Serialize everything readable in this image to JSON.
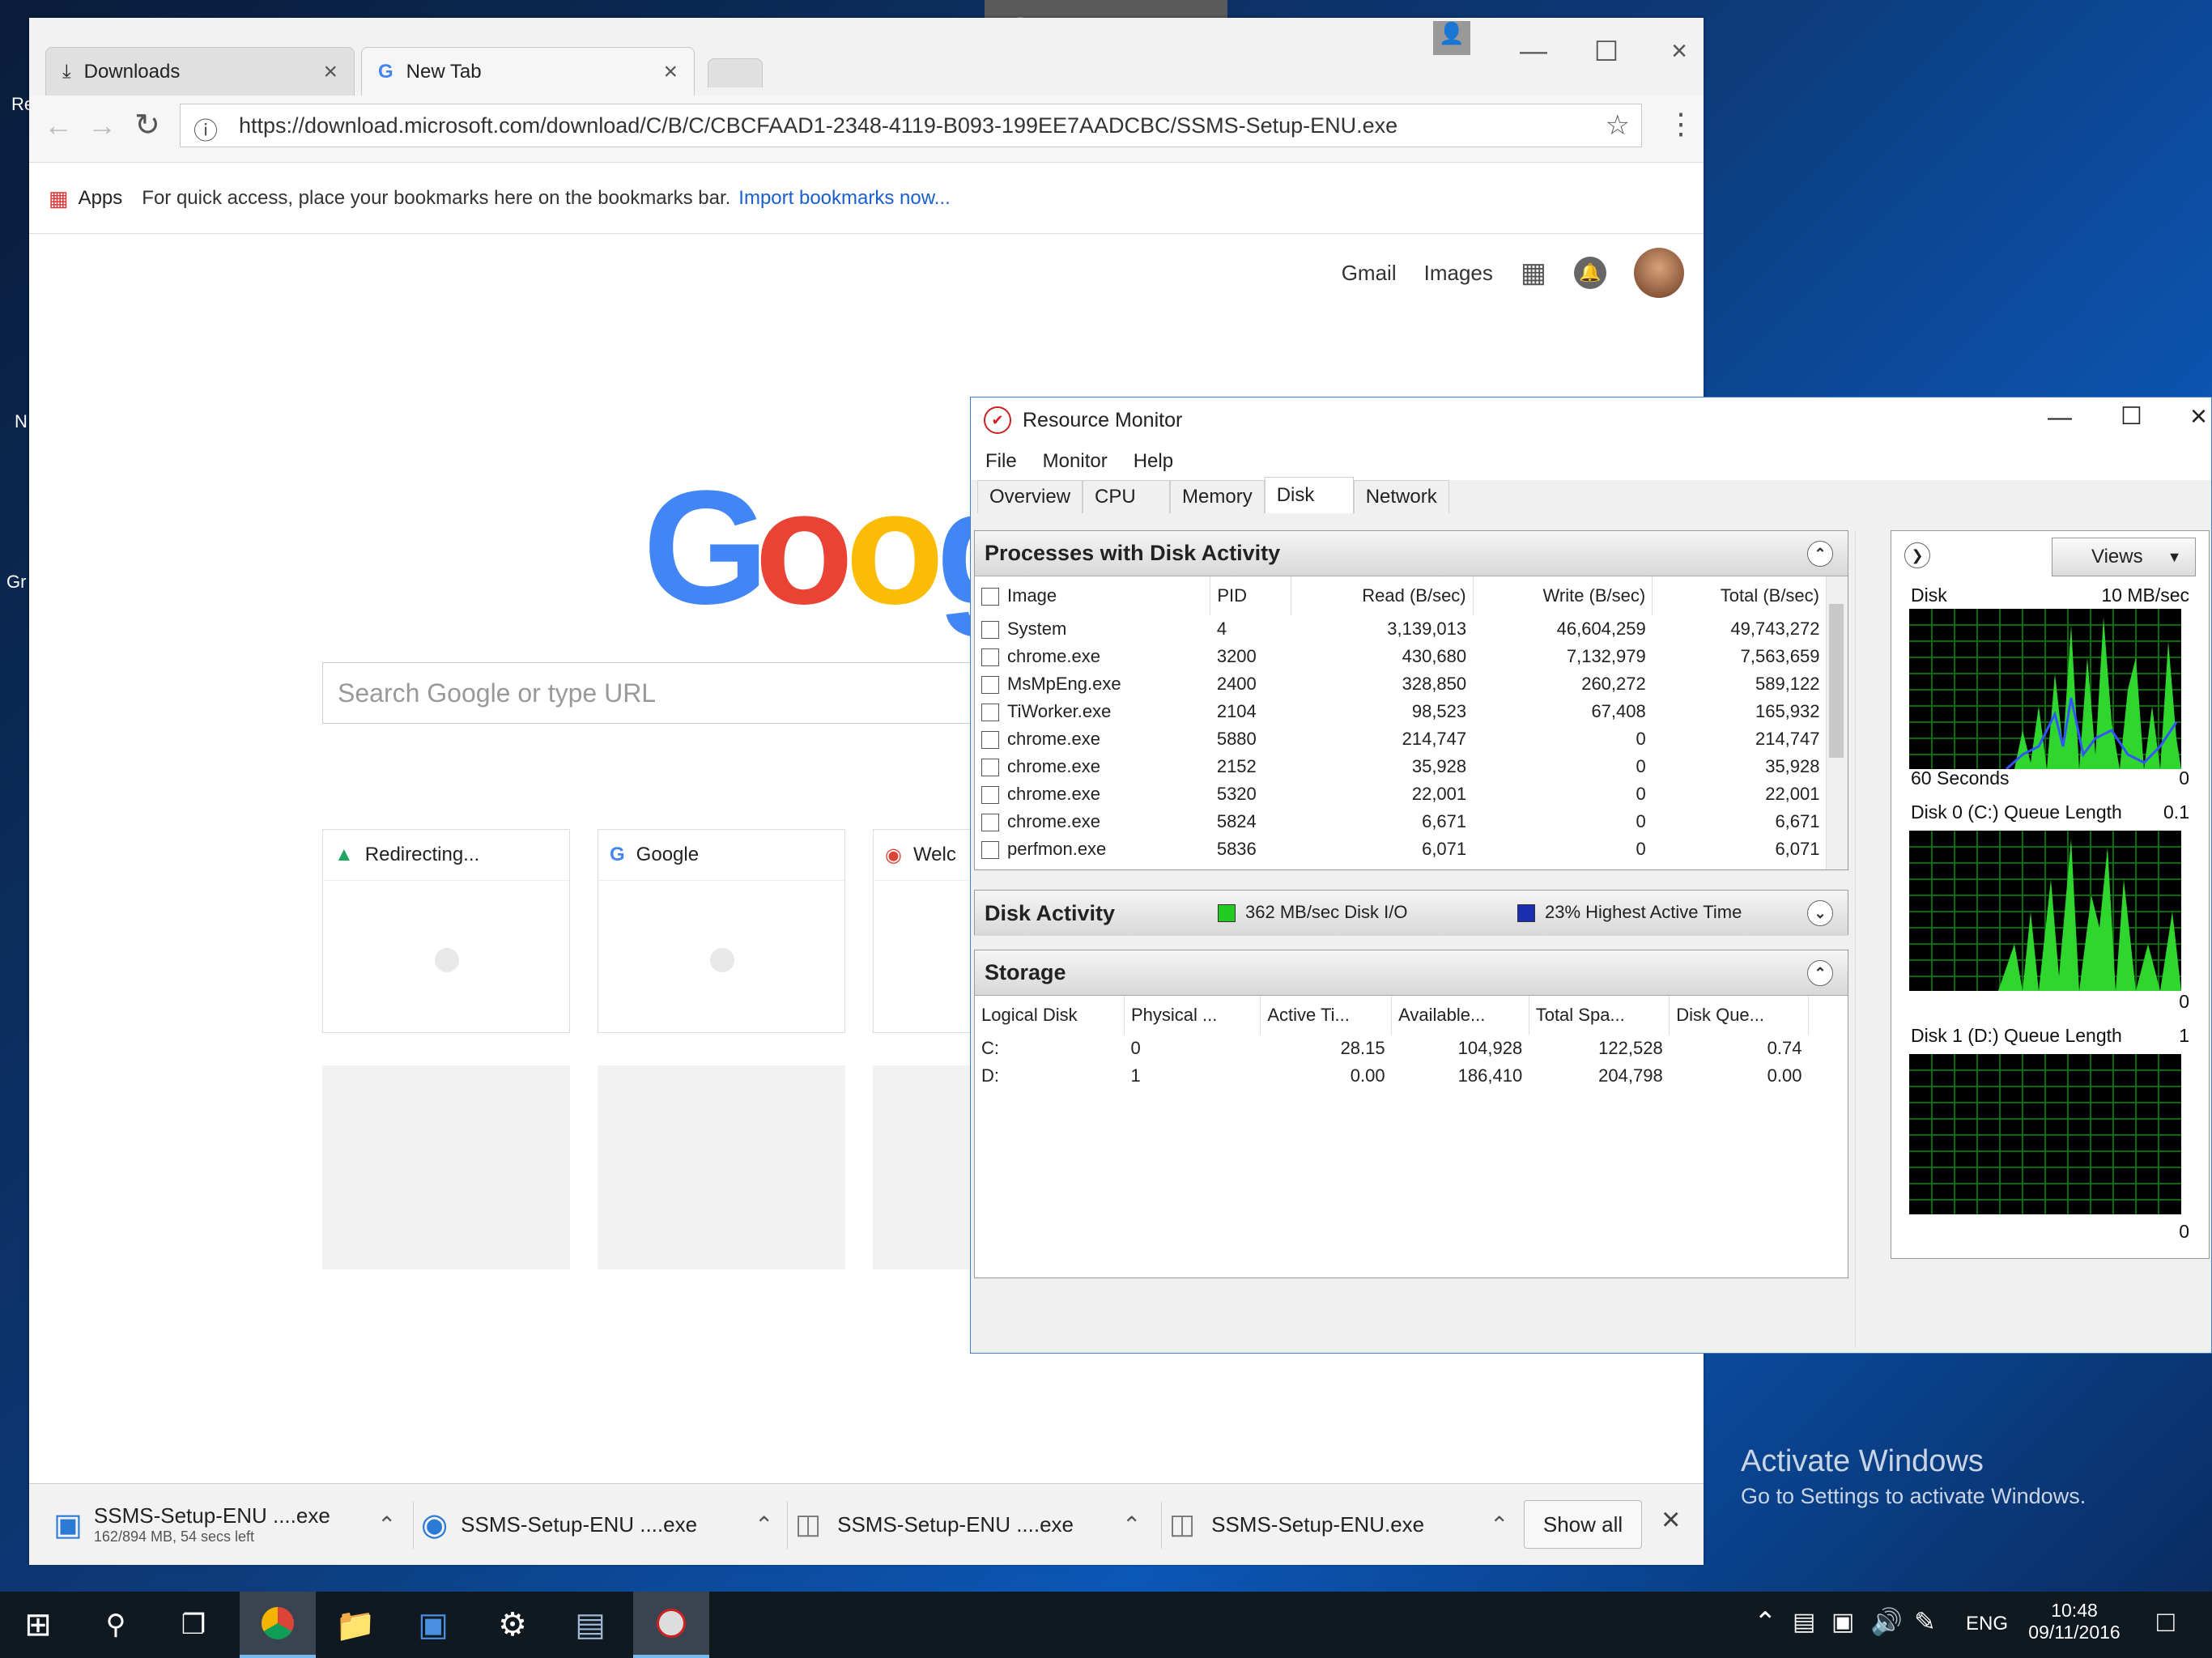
{
  "desktop": {
    "icon_labels": [
      "Re",
      "N",
      "Gr"
    ],
    "activate": {
      "line1": "Activate Windows",
      "line2": "Go to Settings to activate Windows."
    }
  },
  "chrome": {
    "tabs": [
      {
        "label": "Downloads",
        "icon": "download-icon"
      },
      {
        "label": "New Tab",
        "icon": "google-g-icon"
      }
    ],
    "url": "https://download.microsoft.com/download/C/B/C/CBCFAAD1-2348-4119-B093-199EE7AADCBC/SSMS-Setup-ENU.exe",
    "bookmarks": {
      "apps": "Apps",
      "hint": "For quick access, place your bookmarks here on the bookmarks bar.",
      "import_link": "Import bookmarks now..."
    },
    "ntp": {
      "gmail": "Gmail",
      "images": "Images",
      "logo": "Goog",
      "search_placeholder": "Search Google or type URL",
      "tiles": [
        "Redirecting...",
        "Google",
        "Welc"
      ]
    },
    "downloads": [
      {
        "name": "SSMS-Setup-ENU ....exe",
        "status": "162/894 MB, 54 secs left"
      },
      {
        "name": "SSMS-Setup-ENU ....exe"
      },
      {
        "name": "SSMS-Setup-ENU ....exe"
      },
      {
        "name": "SSMS-Setup-ENU.exe"
      }
    ],
    "show_all": "Show all"
  },
  "resmon": {
    "title": "Resource Monitor",
    "menu": [
      "File",
      "Monitor",
      "Help"
    ],
    "tabs": [
      "Overview",
      "CPU",
      "Memory",
      "Disk",
      "Network"
    ],
    "active_tab": "Disk",
    "processes": {
      "title": "Processes with Disk Activity",
      "columns": [
        "Image",
        "PID",
        "Read (B/sec)",
        "Write (B/sec)",
        "Total (B/sec)"
      ],
      "rows": [
        [
          "System",
          "4",
          "3,139,013",
          "46,604,259",
          "49,743,272"
        ],
        [
          "chrome.exe",
          "3200",
          "430,680",
          "7,132,979",
          "7,563,659"
        ],
        [
          "MsMpEng.exe",
          "2400",
          "328,850",
          "260,272",
          "589,122"
        ],
        [
          "TiWorker.exe",
          "2104",
          "98,523",
          "67,408",
          "165,932"
        ],
        [
          "chrome.exe",
          "5880",
          "214,747",
          "0",
          "214,747"
        ],
        [
          "chrome.exe",
          "2152",
          "35,928",
          "0",
          "35,928"
        ],
        [
          "chrome.exe",
          "5320",
          "22,001",
          "0",
          "22,001"
        ],
        [
          "chrome.exe",
          "5824",
          "6,671",
          "0",
          "6,671"
        ],
        [
          "perfmon.exe",
          "5836",
          "6,071",
          "0",
          "6,071"
        ]
      ]
    },
    "disk_activity": {
      "title": "Disk Activity",
      "io": "362 MB/sec Disk I/O",
      "active": "23% Highest Active Time",
      "io_color": "#22cc22",
      "active_color": "#1a2fb0"
    },
    "storage": {
      "title": "Storage",
      "columns": [
        "Logical Disk",
        "Physical ...",
        "Active Ti...",
        "Available...",
        "Total Spa...",
        "Disk Que..."
      ],
      "rows": [
        [
          "C:",
          "0",
          "28.15",
          "104,928",
          "122,528",
          "0.74"
        ],
        [
          "D:",
          "1",
          "0.00",
          "186,410",
          "204,798",
          "0.00"
        ]
      ]
    },
    "graphs": {
      "views": "Views",
      "disk": {
        "label": "Disk",
        "max": "10 MB/sec",
        "time": "60 Seconds",
        "min": "0"
      },
      "disk0": {
        "label": "Disk 0 (C:) Queue Length",
        "max": "0.1",
        "min": "0"
      },
      "disk1": {
        "label": "Disk 1 (D:) Queue Length",
        "max": "1",
        "min": "0"
      }
    }
  },
  "taskbar": {
    "lang": "ENG",
    "time": "10:48",
    "date": "09/11/2016"
  }
}
